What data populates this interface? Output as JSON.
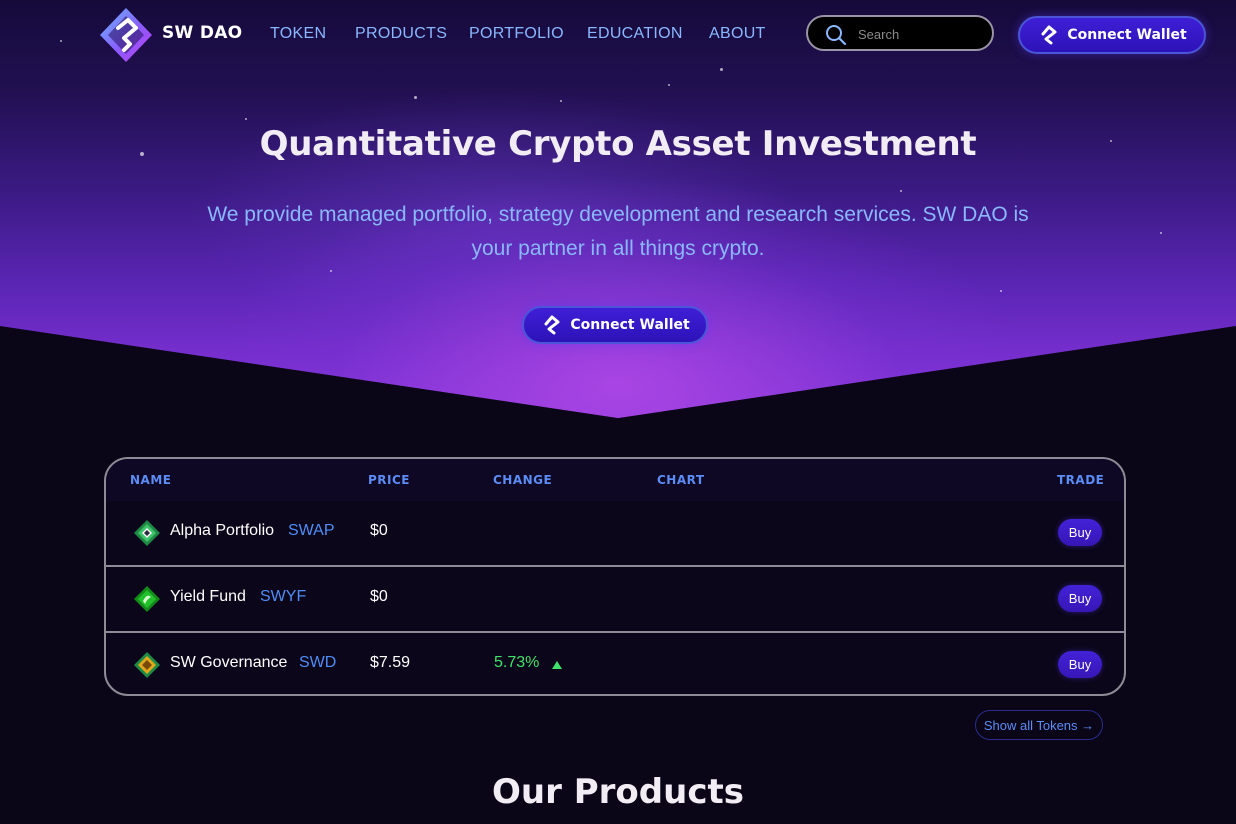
{
  "nav": {
    "brand": "SW DAO",
    "links": [
      "TOKEN",
      "PRODUCTS",
      "PORTFOLIO",
      "EDUCATION",
      "ABOUT"
    ],
    "search_placeholder": "Search",
    "wallet_label": "Connect Wallet"
  },
  "hero": {
    "title": "Quantitative Crypto Asset Investment",
    "subtitle": "We provide managed portfolio, strategy development and research services. SW DAO is your partner in all things crypto.",
    "wallet_label": "Connect Wallet"
  },
  "table": {
    "headers": [
      "NAME",
      "PRICE",
      "CHANGE",
      "CHART",
      "TRADE"
    ],
    "rows": [
      {
        "name": "Alpha Portfolio",
        "symbol": "SWAP",
        "price": "$0",
        "change": "",
        "action": "Buy",
        "icon_color": "#3fc46a",
        "icon": "alpha-token-icon"
      },
      {
        "name": "Yield Fund",
        "symbol": "SWYF",
        "price": "$0",
        "change": "",
        "action": "Buy",
        "icon_color": "#22c02a",
        "icon": "yield-token-icon"
      },
      {
        "name": "SW Governance",
        "symbol": "SWD",
        "price": "$7.59",
        "change": "5.73%",
        "action": "Buy",
        "icon_color": "#e0a81c",
        "icon": "governance-token-icon"
      }
    ],
    "show_all": "Show all Tokens →"
  },
  "products": {
    "title": "Our Products"
  },
  "colors": {
    "accent_blue": "#8ab8ff",
    "header_blue": "#5c8cf5",
    "button_purple": "#3a1ac4",
    "positive_green": "#3fe36a"
  }
}
